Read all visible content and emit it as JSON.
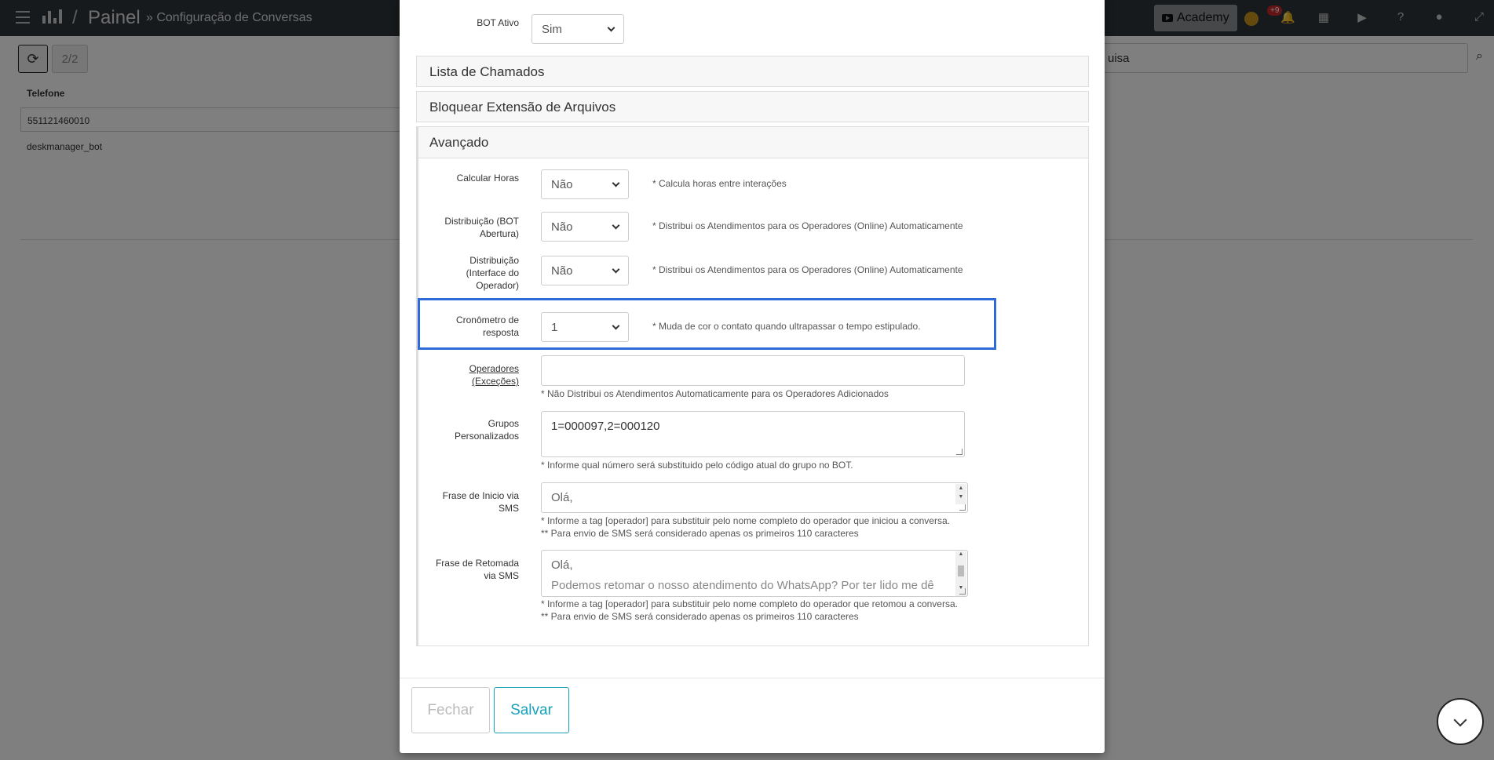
{
  "topbar": {
    "breadcrumb_sep": "/",
    "app_title": "Painel",
    "page_subtitle": "» Configuração de Conversas",
    "academy_label": "Academy",
    "notif_badge": "+9"
  },
  "toolbar": {
    "pager": "2/2",
    "search_value": "uisa"
  },
  "table": {
    "column_header": "Telefone",
    "rows": [
      "551121460010",
      "deskmanager_bot"
    ]
  },
  "modal": {
    "bot_ativo": {
      "label": "BOT Ativo",
      "value": "Sim"
    },
    "panels": {
      "chamados": "Lista de Chamados",
      "bloquear": "Bloquear Extensão de Arquivos",
      "avancado": "Avançado"
    },
    "calcular_horas": {
      "label": "Calcular Horas",
      "value": "Não",
      "hint": "* Calcula horas entre interações"
    },
    "dist_bot": {
      "label": "Distribuição (BOT Abertura)",
      "value": "Não",
      "hint": "* Distribui os Atendimentos para os Operadores (Online) Automaticamente"
    },
    "dist_interface": {
      "label": "Distribuição (Interface do Operador)",
      "value": "Não",
      "hint": "* Distribui os Atendimentos para os Operadores (Online) Automaticamente"
    },
    "cronometro": {
      "label": "Cronômetro de resposta",
      "value": "1",
      "hint": "* Muda de cor o contato quando ultrapassar o tempo estipulado."
    },
    "operadores": {
      "label": "Operadores (Exceções)",
      "value": "",
      "hint": "* Não Distribui os Atendimentos Automaticamente para os Operadores Adicionados"
    },
    "grupos": {
      "label": "Grupos Personalizados",
      "value": "1=000097,2=000120",
      "hint": "* Informe qual número será substituido pelo código atual do grupo no BOT."
    },
    "frase_inicio": {
      "label": "Frase de Inicio via SMS",
      "value": "Olá,",
      "hint1": "* Informe a tag [operador] para substituir pelo nome completo do operador que iniciou a conversa.",
      "hint2": "** Para envio de SMS será considerado apenas os primeiros 110 caracteres"
    },
    "frase_retomada": {
      "label": "Frase de Retomada via SMS",
      "value": "Olá,",
      "value_line2": "Podemos retomar o nosso atendimento do WhatsApp? Por ter lido me dê ",
      "hint1": "* Informe a tag [operador] para substituir pelo nome completo do operador que retomou a conversa.",
      "hint2": "** Para envio de SMS será considerado apenas os primeiros 110 caracteres"
    },
    "buttons": {
      "fechar": "Fechar",
      "salvar": "Salvar"
    }
  },
  "colors": {
    "highlight": "#2f6bd8",
    "accent": "#17a2b8",
    "topbar": "#2f3439",
    "badge": "#c62828"
  }
}
